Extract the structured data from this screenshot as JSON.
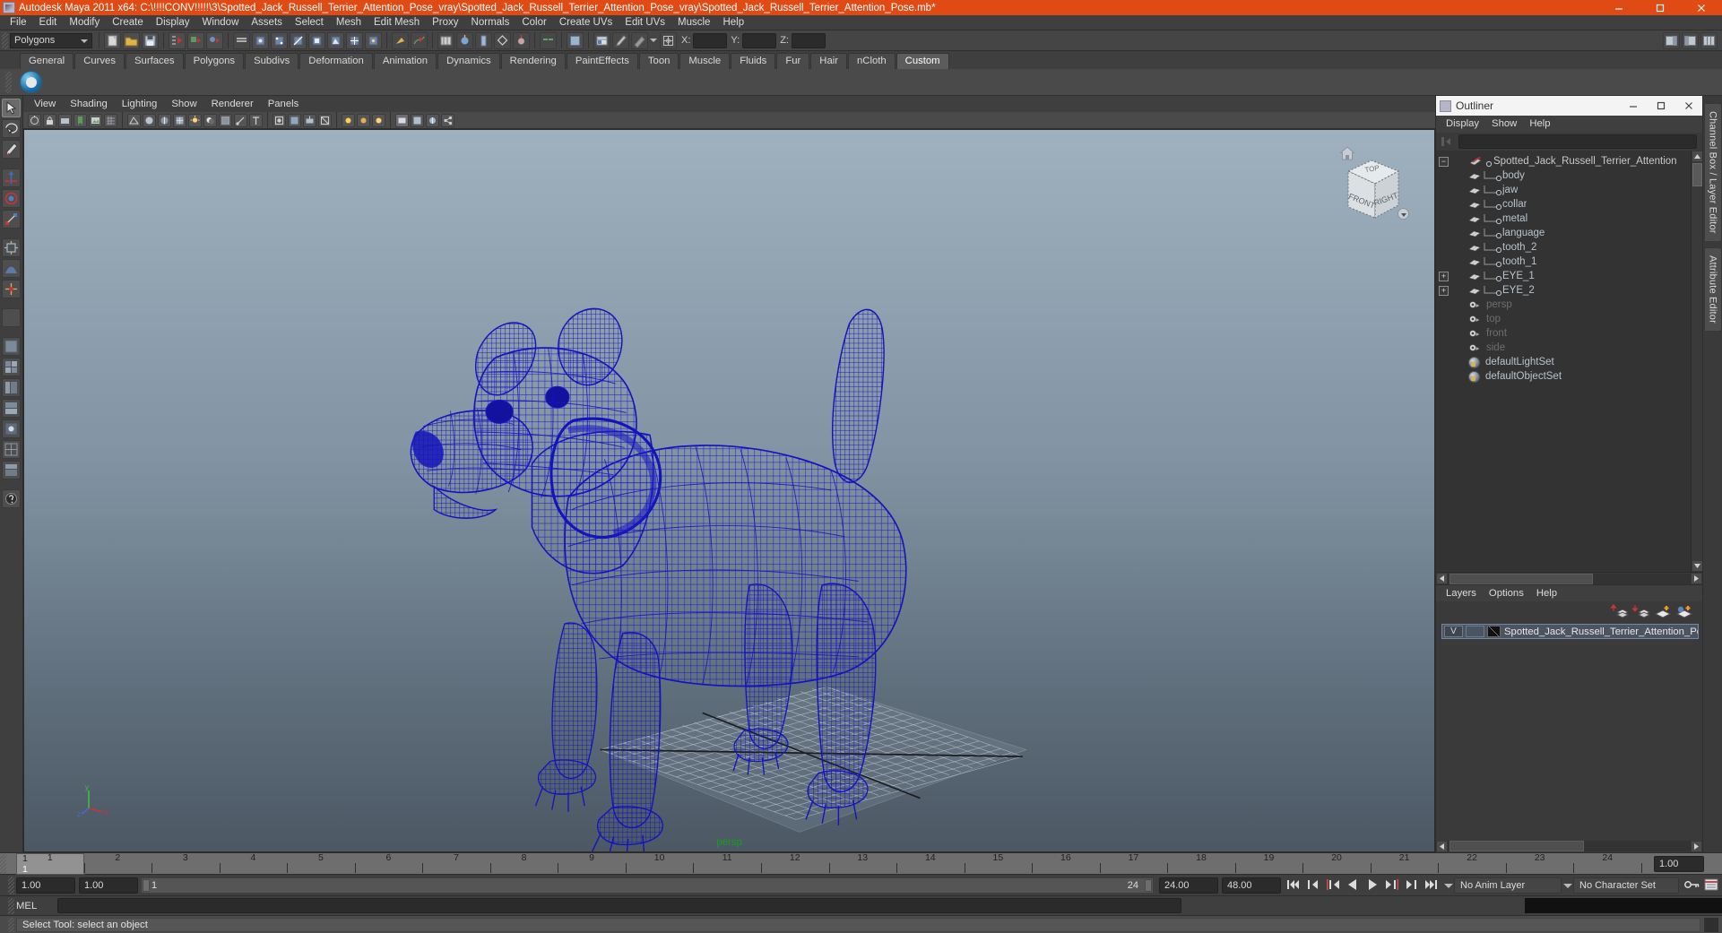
{
  "window": {
    "title": "Autodesk Maya 2011 x64: C:\\!!!!CONV!!!!!\\3\\Spotted_Jack_Russell_Terrier_Attention_Pose_vray\\Spotted_Jack_Russell_Terrier_Attention_Pose_vray\\Spotted_Jack_Russell_Terrier_Attention_Pose.mb*",
    "app_icon": "maya-icon",
    "minimize": "minimize-icon",
    "maximize": "maximize-icon",
    "close": "close-icon",
    "titlebar_color": "#e04a14"
  },
  "menubar": {
    "items": [
      "File",
      "Edit",
      "Modify",
      "Create",
      "Display",
      "Window",
      "Assets",
      "Select",
      "Mesh",
      "Edit Mesh",
      "Proxy",
      "Normals",
      "Color",
      "Create UVs",
      "Edit UVs",
      "Muscle",
      "Help"
    ]
  },
  "statusbar": {
    "mode_selector": "Polygons",
    "axis_fields": [
      {
        "label": "X:",
        "value": ""
      },
      {
        "label": "Y:",
        "value": ""
      },
      {
        "label": "Z:",
        "value": ""
      }
    ]
  },
  "shelf": {
    "tabs": [
      "General",
      "Curves",
      "Surfaces",
      "Polygons",
      "Subdivs",
      "Deformation",
      "Animation",
      "Dynamics",
      "Rendering",
      "PaintEffects",
      "Toon",
      "Muscle",
      "Fluids",
      "Fur",
      "Hair",
      "nCloth",
      "Custom"
    ],
    "active_tab": "Custom",
    "button_icon": "blue-sphere-shelf-icon"
  },
  "viewport": {
    "menus": [
      "View",
      "Shading",
      "Lighting",
      "Show",
      "Renderer",
      "Panels"
    ],
    "camera_label": "persp",
    "camera_label_color": "#16a016",
    "viewcube": {
      "top": "TOP",
      "front": "FRONT",
      "right": "RIGHT"
    },
    "home_icon": "home-icon",
    "viewcube_menu_icon": "chevron-down-icon",
    "axis_gizmo": {
      "y": "y",
      "x": "x",
      "z": "z"
    },
    "wireframe_color": "#1a1ac8"
  },
  "outliner": {
    "title": "Outliner",
    "menus": [
      "Display",
      "Show",
      "Help"
    ],
    "search_value": "",
    "items": [
      {
        "label": "Spotted_Jack_Russell_Terrier_Attention",
        "icon": "group-icon",
        "expander": "minus",
        "depth": 0,
        "style": "white"
      },
      {
        "label": "body",
        "icon": "mesh-icon",
        "expander": "none",
        "depth": 1,
        "style": "normal"
      },
      {
        "label": "jaw",
        "icon": "mesh-icon",
        "expander": "none",
        "depth": 1,
        "style": "normal"
      },
      {
        "label": "collar",
        "icon": "mesh-icon",
        "expander": "none",
        "depth": 1,
        "style": "normal"
      },
      {
        "label": "metal",
        "icon": "mesh-icon",
        "expander": "none",
        "depth": 1,
        "style": "normal"
      },
      {
        "label": "language",
        "icon": "mesh-icon",
        "expander": "none",
        "depth": 1,
        "style": "normal"
      },
      {
        "label": "tooth_2",
        "icon": "mesh-icon",
        "expander": "none",
        "depth": 1,
        "style": "normal"
      },
      {
        "label": "tooth_1",
        "icon": "mesh-icon",
        "expander": "none",
        "depth": 1,
        "style": "normal"
      },
      {
        "label": "EYE_1",
        "icon": "mesh-icon",
        "expander": "plus",
        "depth": 1,
        "style": "normal"
      },
      {
        "label": "EYE_2",
        "icon": "mesh-icon",
        "expander": "plus",
        "depth": 1,
        "style": "normal"
      },
      {
        "label": "persp",
        "icon": "camera-icon",
        "expander": "none",
        "depth": 0,
        "style": "dim"
      },
      {
        "label": "top",
        "icon": "camera-icon",
        "expander": "none",
        "depth": 0,
        "style": "dim"
      },
      {
        "label": "front",
        "icon": "camera-icon",
        "expander": "none",
        "depth": 0,
        "style": "dim"
      },
      {
        "label": "side",
        "icon": "camera-icon",
        "expander": "none",
        "depth": 0,
        "style": "dim"
      },
      {
        "label": "defaultLightSet",
        "icon": "set-icon",
        "expander": "none",
        "depth": 0,
        "style": "normal"
      },
      {
        "label": "defaultObjectSet",
        "icon": "set-icon",
        "expander": "none",
        "depth": 0,
        "style": "normal"
      }
    ]
  },
  "layer_editor": {
    "menus": [
      "Layers",
      "Options",
      "Help"
    ],
    "tool_icons": [
      "move-layer-up-icon",
      "move-layer-down-icon",
      "new-layer-icon",
      "new-layer-from-selected-icon"
    ],
    "layers": [
      {
        "visibility": "V",
        "playback": "",
        "shading": "layer-color-swatch",
        "name": "Spotted_Jack_Russell_Terrier_Attention_Po"
      }
    ]
  },
  "right_tabs": [
    "Channel Box / Layer Editor",
    "Attribute Editor"
  ],
  "timeline": {
    "current_frame_label": "1",
    "ticks": [
      1,
      2,
      3,
      4,
      5,
      6,
      7,
      8,
      9,
      10,
      11,
      12,
      13,
      14,
      15,
      16,
      17,
      18,
      19,
      20,
      21,
      22,
      23,
      24
    ],
    "current_frame_field": "1.00"
  },
  "range": {
    "start_field": "1.00",
    "end_field": "1.00",
    "slider_start": "1",
    "slider_end": "24",
    "anim_start_field": "24.00",
    "anim_end_field": "48.00",
    "anim_layer": "No Anim Layer",
    "character_set": "No Character Set",
    "playback_buttons": [
      "go-to-start-icon",
      "step-back-keyframe-icon",
      "step-back-frame-icon",
      "play-backwards-icon",
      "play-forwards-icon",
      "step-forward-frame-icon",
      "step-forward-keyframe-icon",
      "go-to-end-icon"
    ],
    "key_icon": "key-icon",
    "anim_prefs_icon": "animation-preferences-icon"
  },
  "command_line": {
    "language_label": "MEL",
    "input_value": ""
  },
  "help_line": {
    "text": "Select Tool: select an object"
  }
}
